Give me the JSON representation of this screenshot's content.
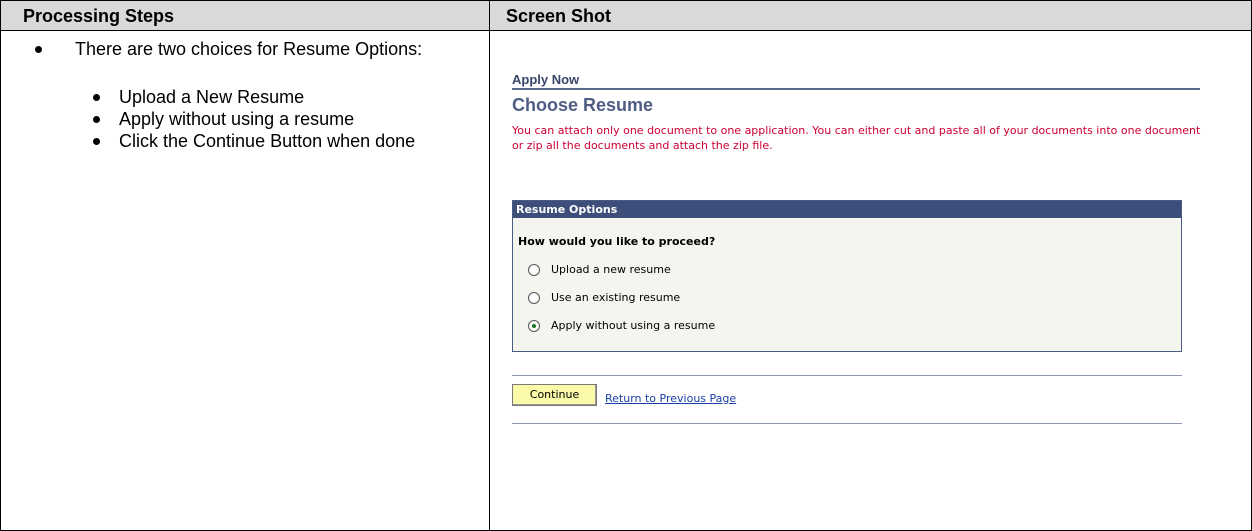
{
  "table": {
    "col_left_header": "Processing Steps",
    "col_right_header": "Screen Shot"
  },
  "steps": {
    "main": "There are two choices for Resume Options:",
    "sub": [
      "Upload a New Resume",
      "Apply without using a resume",
      "Click the Continue Button when done"
    ]
  },
  "screenshot": {
    "section_label": "Apply Now",
    "title": "Choose Resume",
    "notice": "You can attach only one document to one application. You can either cut and paste all of your documents into one document or zip all the documents and attach the zip file.",
    "options_header": "Resume Options",
    "question": "How would you like to proceed?",
    "options": [
      {
        "label": "Upload a new resume",
        "checked": false
      },
      {
        "label": "Use an existing resume",
        "checked": false
      },
      {
        "label": "Apply without using a resume",
        "checked": true
      }
    ],
    "continue_label": "Continue",
    "return_link": "Return to Previous Page"
  },
  "colors": {
    "header_bg": "#d9d9d9",
    "title_blue": "#4f5d85",
    "notice_red": "#cc0033",
    "options_head_bg": "#3d4e7a",
    "continue_bg": "#fafaa8",
    "link_blue": "#1a3fa8"
  }
}
